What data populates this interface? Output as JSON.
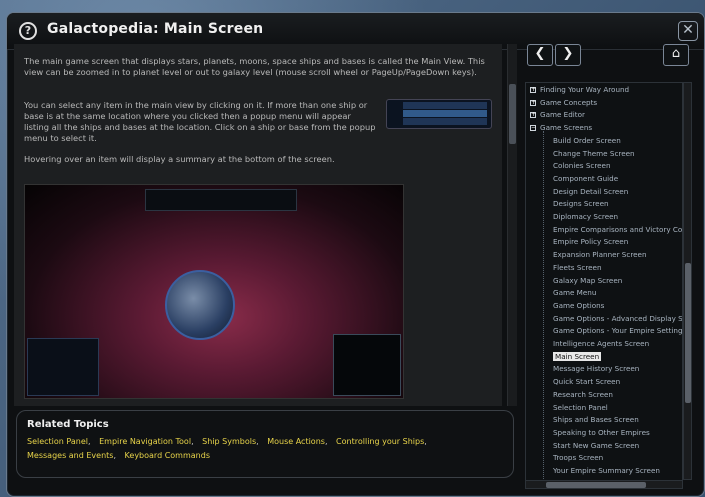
{
  "window": {
    "title": "Galactopedia: Main Screen",
    "close_glyph": "✕",
    "help_glyph": "?"
  },
  "article": {
    "paragraphs": [
      "The main game screen that displays stars, planets, moons, space ships and bases is called the Main View. This view can be zoomed in to planet level or out to galaxy level (mouse scroll wheel or PageUp/PageDown keys).",
      "You can select any item in the main view by clicking on it. If more than one ship or base is at the same location where you clicked then a popup menu will appear listing all the ships and bases at the location. Click on a ship or base from the popup menu to select it.",
      "Hovering over an item will display a summary at the bottom of the screen."
    ]
  },
  "related": {
    "title": "Related Topics",
    "links": [
      "Selection Panel",
      "Empire Navigation Tool",
      "Ship Symbols",
      "Mouse Actions",
      "Controlling your Ships",
      "Messages and Events",
      "Keyboard Commands"
    ]
  },
  "nav": {
    "back": "❮",
    "forward": "❯",
    "home": "⌂"
  },
  "tree": {
    "top_items": [
      "Finding Your Way Around",
      "Game Concepts",
      "Game Editor",
      "Game Screens"
    ],
    "expand_glyphs": [
      "+",
      "+",
      "+",
      "−"
    ],
    "children": [
      "Build Order Screen",
      "Change Theme Screen",
      "Colonies Screen",
      "Component Guide",
      "Design Detail Screen",
      "Designs Screen",
      "Diplomacy Screen",
      "Empire Comparisons and Victory Con",
      "Empire Policy Screen",
      "Expansion Planner Screen",
      "Fleets Screen",
      "Galaxy Map Screen",
      "Game Menu",
      "Game Options",
      "Game Options - Advanced Display Setti",
      "Game Options - Your Empire Settings S",
      "Intelligence Agents Screen",
      "Main Screen",
      "Message History Screen",
      "Quick Start Screen",
      "Research Screen",
      "Selection Panel",
      "Ships and Bases Screen",
      "Speaking to Other Empires",
      "Start New Game Screen",
      "Troops Screen",
      "Your Empire Summary Screen"
    ],
    "selected": "Main Screen"
  }
}
